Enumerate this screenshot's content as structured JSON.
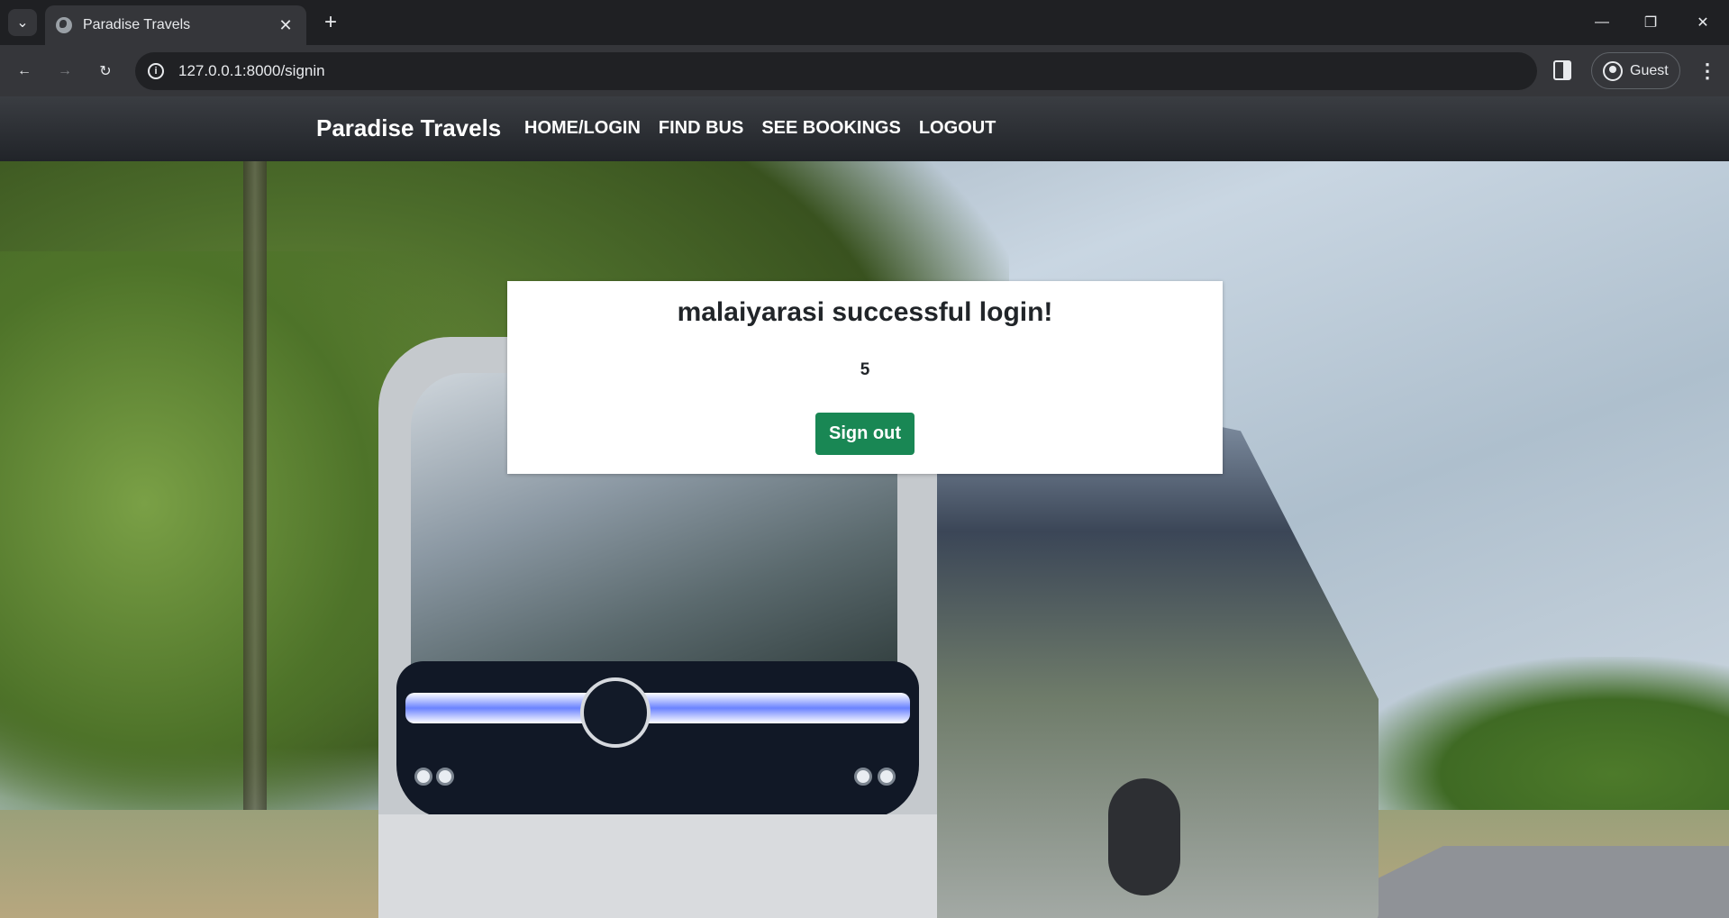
{
  "browser": {
    "tab_title": "Paradise Travels",
    "url": "127.0.0.1:8000/signin",
    "profile_label": "Guest"
  },
  "site": {
    "brand": "Paradise Travels",
    "nav": [
      "HOME/LOGIN",
      "FIND BUS",
      "SEE BOOKINGS",
      "LOGOUT"
    ]
  },
  "card": {
    "title": "malaiyarasi successful login!",
    "value": "5",
    "signout_label": "Sign out"
  },
  "colors": {
    "button": "#198754",
    "navbar": "#2b2e33"
  }
}
